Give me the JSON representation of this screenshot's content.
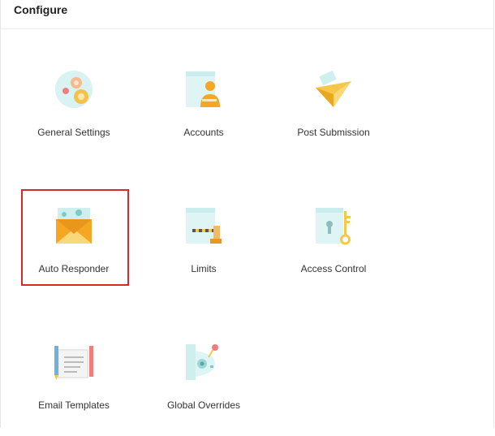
{
  "page": {
    "title": "Configure"
  },
  "tiles": [
    {
      "label": "General Settings",
      "icon": "gear-settings-icon"
    },
    {
      "label": "Accounts",
      "icon": "accounts-icon"
    },
    {
      "label": "Post Submission",
      "icon": "paper-plane-icon"
    },
    {
      "label": "Auto Responder",
      "icon": "envelope-icon",
      "selected": true
    },
    {
      "label": "Limits",
      "icon": "limits-barrier-icon"
    },
    {
      "label": "Access Control",
      "icon": "key-lock-icon"
    },
    {
      "label": "Email Templates",
      "icon": "email-templates-icon"
    },
    {
      "label": "Global Overrides",
      "icon": "global-overrides-icon"
    }
  ],
  "colors": {
    "selection": "#d32a2a",
    "accent_orange": "#f5a623",
    "accent_teal": "#dff5f5"
  }
}
